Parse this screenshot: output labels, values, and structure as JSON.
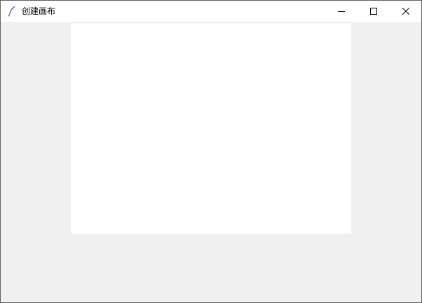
{
  "window": {
    "title": "创建画布",
    "app_icon": "feather-icon",
    "controls": {
      "minimize_icon": "minimize-icon",
      "maximize_icon": "maximize-icon",
      "close_icon": "close-icon"
    }
  },
  "canvas": {
    "background": "#ffffff"
  },
  "colors": {
    "client_background": "#f0f0f0",
    "titlebar_background": "#ffffff",
    "frame_border": "#5f5f5f"
  }
}
